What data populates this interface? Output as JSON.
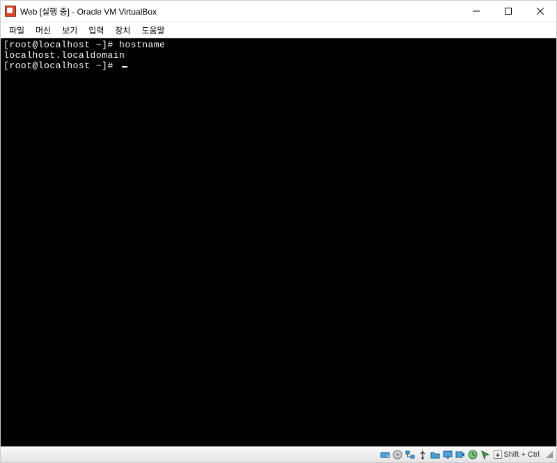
{
  "titlebar": {
    "title": "Web [실행 중] - Oracle VM VirtualBox"
  },
  "menubar": {
    "items": [
      "파일",
      "머신",
      "보기",
      "입력",
      "장치",
      "도움말"
    ]
  },
  "terminal": {
    "lines": [
      "[root@localhost ~]# hostname",
      "localhost.localdomain",
      "[root@localhost ~]# "
    ]
  },
  "statusbar": {
    "hostkey": "Shift + Ctrl"
  }
}
